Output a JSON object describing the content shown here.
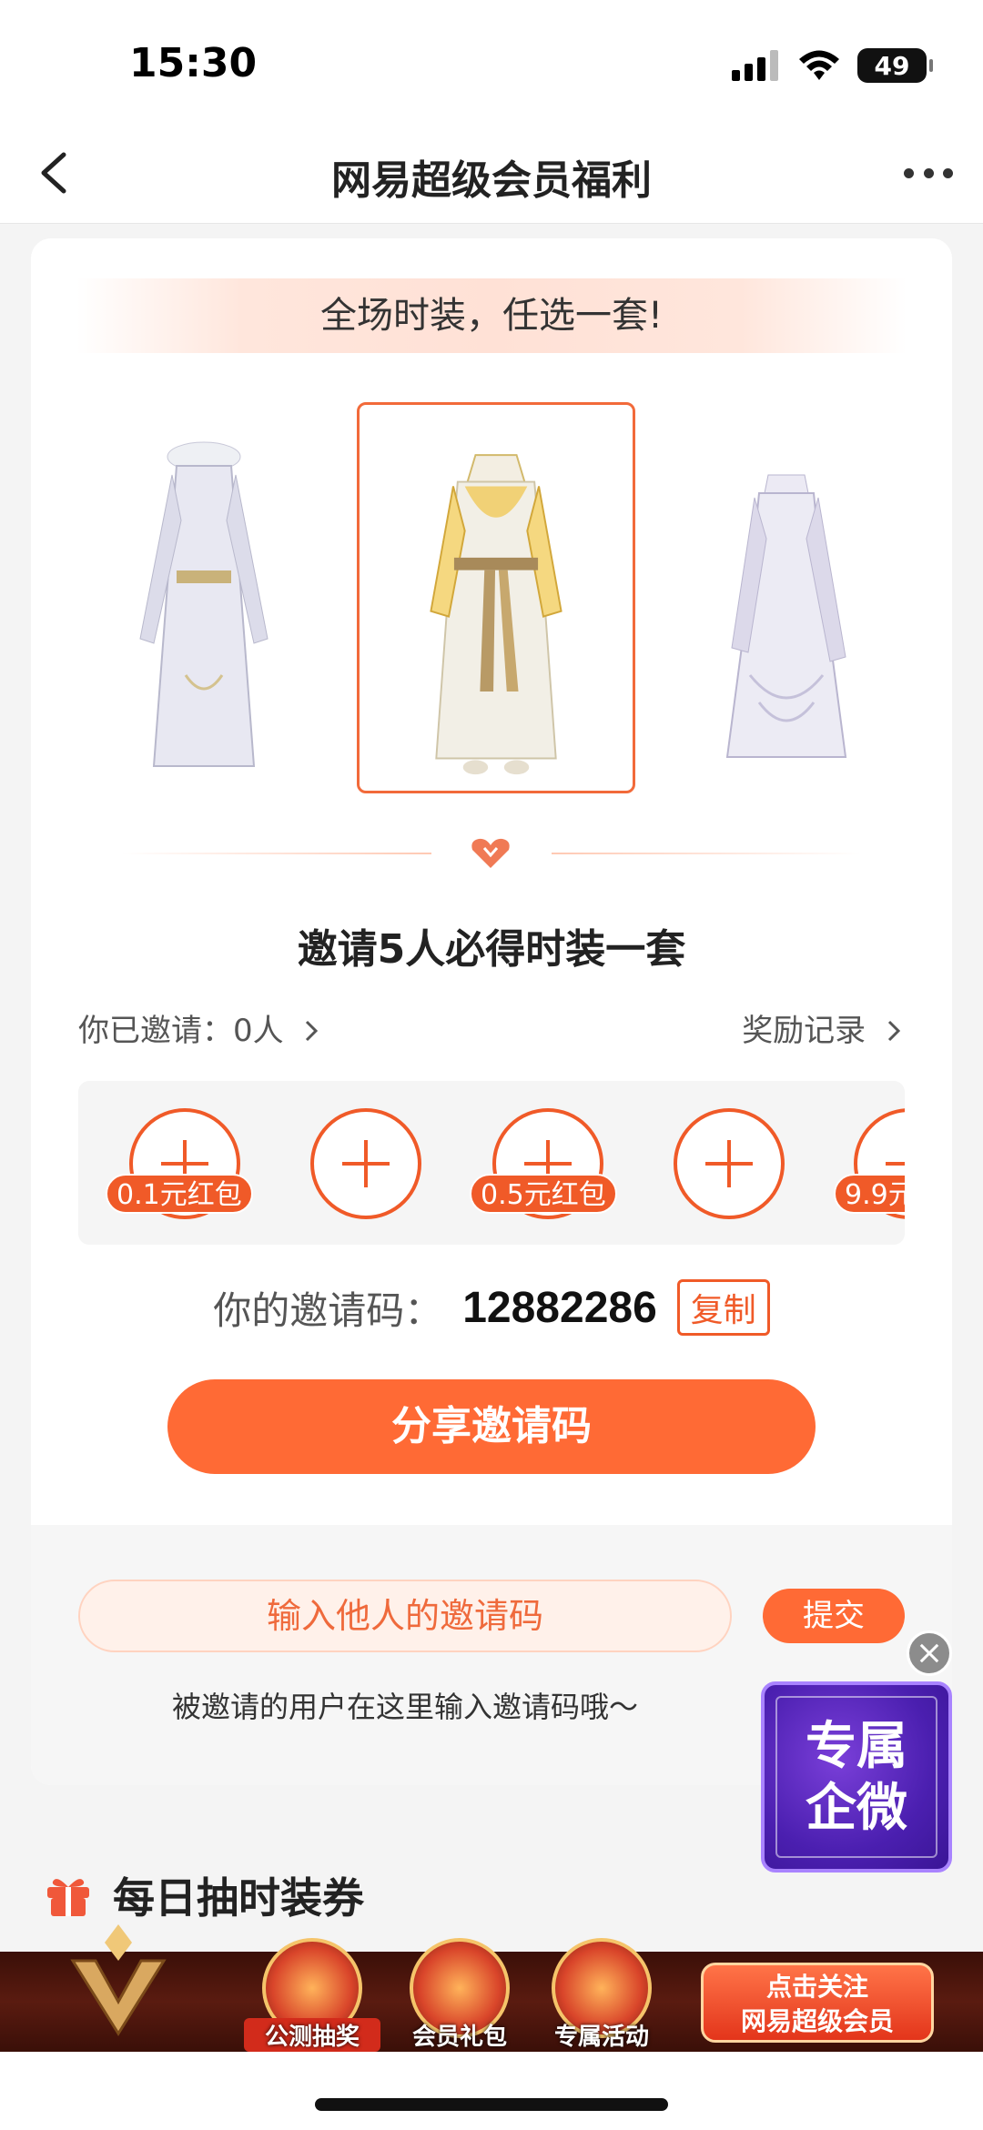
{
  "status_bar": {
    "time": "15:30",
    "battery": "49"
  },
  "nav": {
    "title": "网易超级会员福利"
  },
  "banner": {
    "text": "全场时装，任选一套!"
  },
  "outfits": [
    {
      "icon": "outfit-white-robe"
    },
    {
      "icon": "outfit-gold-robe",
      "selected": true
    },
    {
      "icon": "outfit-lavender-dress"
    }
  ],
  "invite": {
    "title": "邀请5人必得时装一套",
    "invited_count": "你已邀请：0人",
    "reward_records": "奖励记录",
    "slots": [
      {
        "tag": "0.1元红包"
      },
      {
        "tag": ""
      },
      {
        "tag": "0.5元红包"
      },
      {
        "tag": ""
      },
      {
        "tag": "9.9元"
      }
    ],
    "code_label": "你的邀请码：",
    "code": "12882286",
    "copy_label": "复制",
    "share_label": "分享邀请码"
  },
  "enter_code": {
    "placeholder": "输入他人的邀请码",
    "submit_label": "提交",
    "hint": "被邀请的用户在这里输入邀请码哦～"
  },
  "float_widget": {
    "line1": "专属",
    "line2": "企微"
  },
  "daily": {
    "title": "每日抽时装券"
  },
  "bottom_banner": {
    "items": [
      "公测抽奖",
      "会员礼包",
      "专属活动"
    ],
    "follow_line1": "点击关注",
    "follow_line2": "网易超级会员"
  },
  "colors": {
    "accent": "#f05a28",
    "button": "#ff6a35"
  }
}
